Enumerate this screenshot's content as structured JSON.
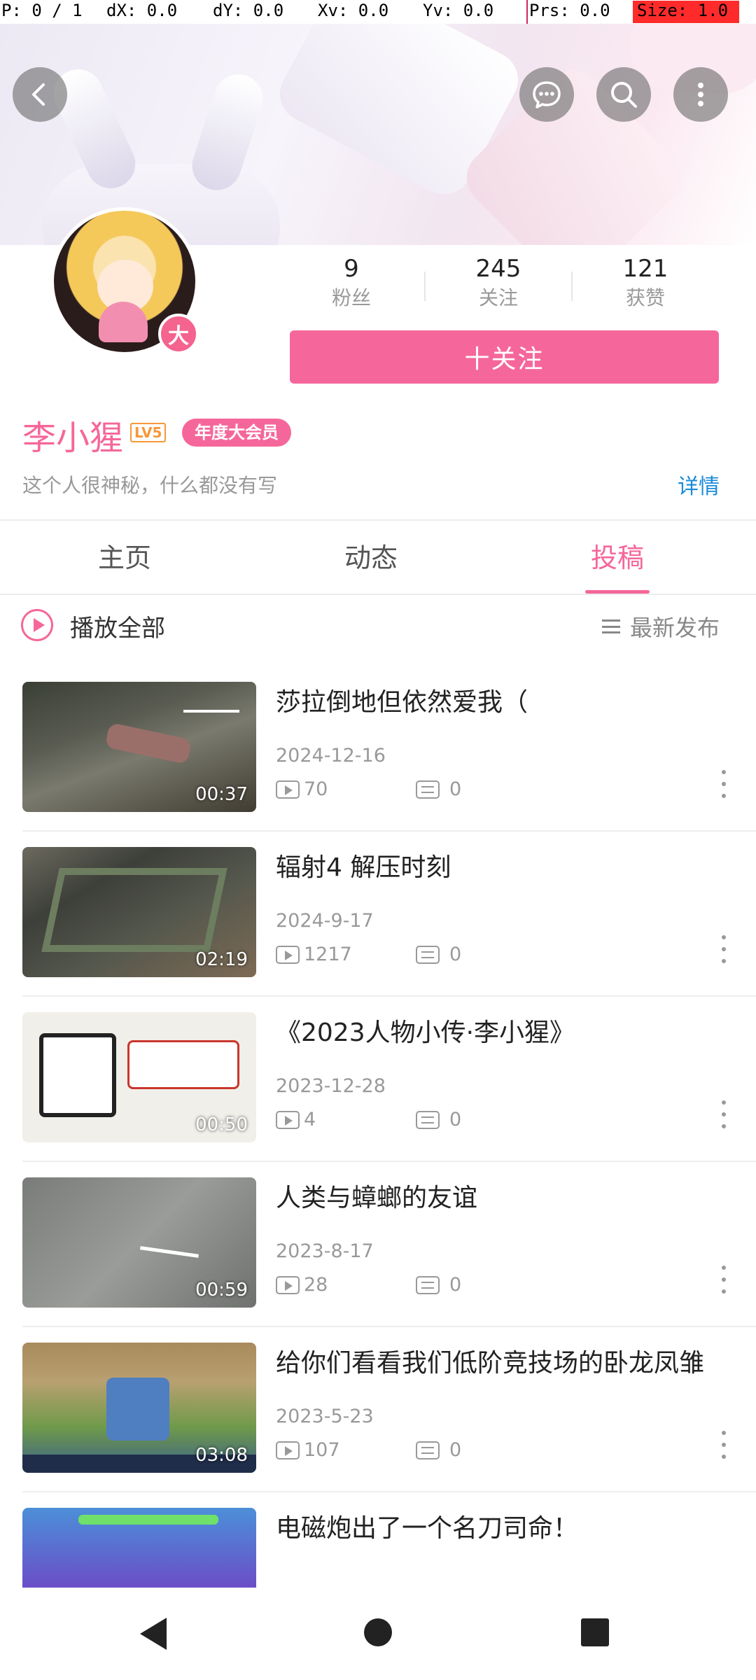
{
  "debug": {
    "pointer": "P: 0 / 1",
    "dx": "dX: 0.0",
    "dy": "dY: 0.0",
    "xv": "Xv: 0.0",
    "yv": "Yv: 0.0",
    "prs": "Prs: 0.0",
    "size": "Size: 1.0"
  },
  "header": {
    "back_icon": "chevron-left-icon",
    "message_icon": "chat-bubble-icon",
    "search_icon": "search-icon",
    "more_icon": "more-vertical-icon"
  },
  "profile": {
    "vip_badge": "大",
    "stats": [
      {
        "value": "9",
        "label": "粉丝"
      },
      {
        "value": "245",
        "label": "关注"
      },
      {
        "value": "121",
        "label": "获赞"
      }
    ],
    "follow_label": "十关注",
    "username": "李小猩",
    "level": "LV5",
    "vip_tag": "年度大会员",
    "bio": "这个人很神秘，什么都没有写",
    "detail_label": "详情"
  },
  "tabs": [
    {
      "label": "主页",
      "active": false
    },
    {
      "label": "动态",
      "active": false
    },
    {
      "label": "投稿",
      "active": true
    }
  ],
  "list_header": {
    "play_all": "播放全部",
    "sort_label": "最新发布"
  },
  "videos": [
    {
      "title": "莎拉倒地但依然爱我（",
      "date": "2024-12-16",
      "views": "70",
      "comments": "0",
      "duration": "00:37"
    },
    {
      "title": "辐射4 解压时刻",
      "date": "2024-9-17",
      "views": "1217",
      "comments": "0",
      "duration": "02:19"
    },
    {
      "title": "《2023人物小传·李小猩》",
      "date": "2023-12-28",
      "views": "4",
      "comments": "0",
      "duration": "00:50"
    },
    {
      "title": "人类与蟑螂的友谊",
      "date": "2023-8-17",
      "views": "28",
      "comments": "0",
      "duration": "00:59"
    },
    {
      "title": "给你们看看我们低阶竞技场的卧龙凤雏",
      "date": "2023-5-23",
      "views": "107",
      "comments": "0",
      "duration": "03:08"
    },
    {
      "title": "电磁炮出了一个名刀司命！",
      "date": "",
      "views": "",
      "comments": "",
      "duration": ""
    }
  ],
  "colors": {
    "accent": "#f5679a",
    "link": "#1a8bd8",
    "level": "#f7983a"
  }
}
